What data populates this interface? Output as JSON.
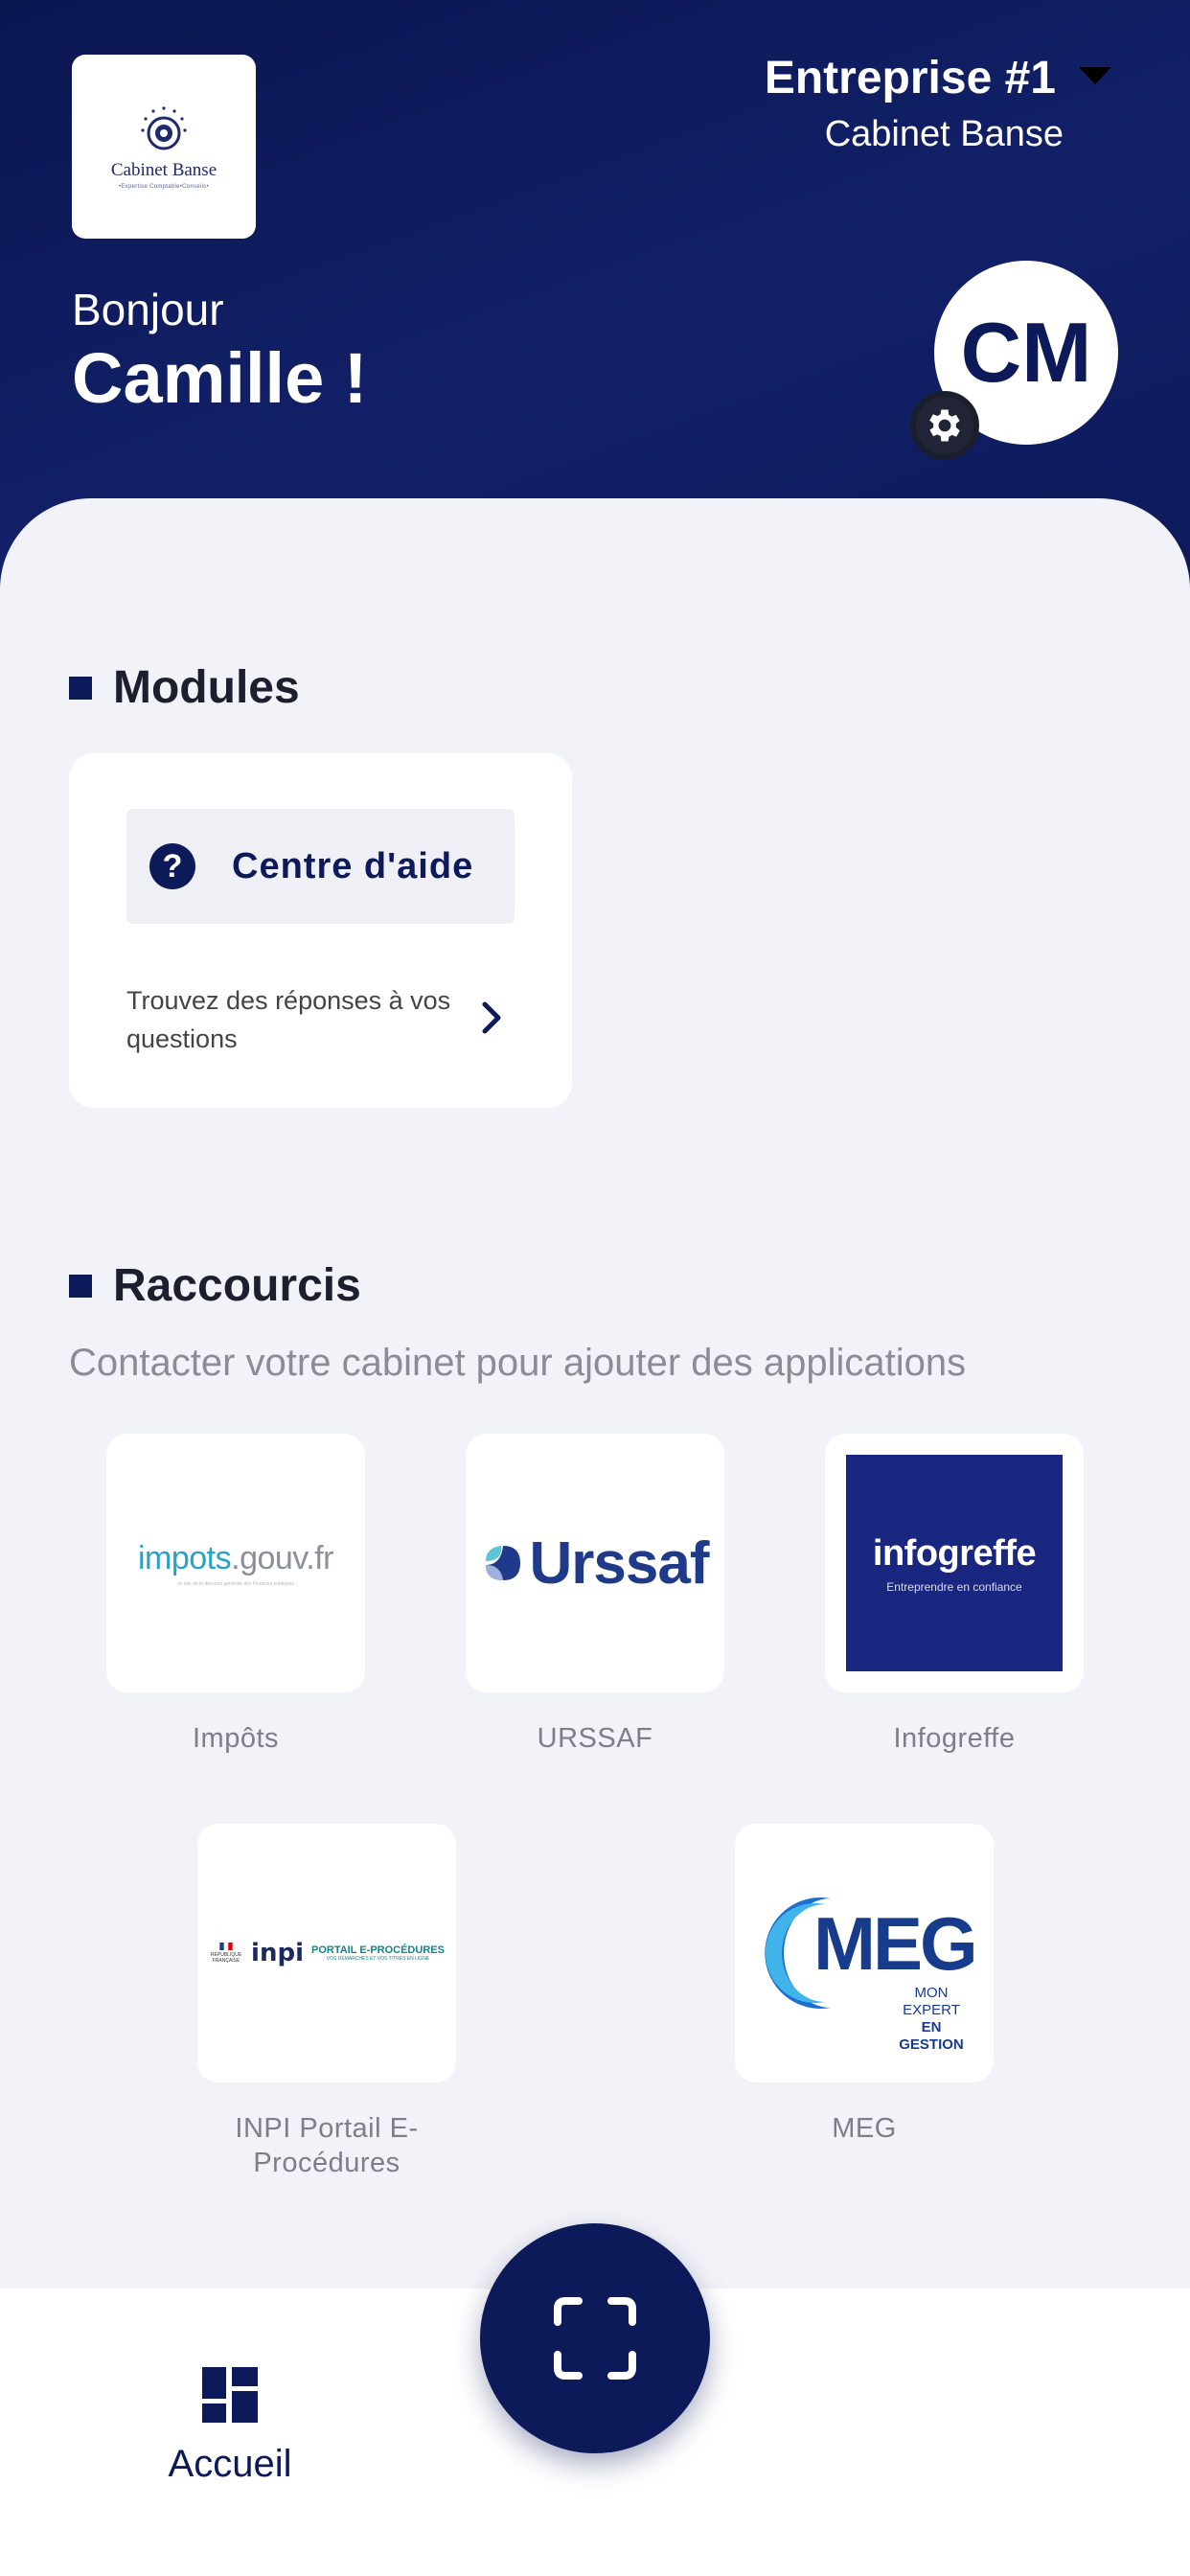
{
  "header": {
    "logo": {
      "name": "Cabinet Banse",
      "tagline": "•Expertise Comptable•Conseils•"
    },
    "company": {
      "name": "Entreprise #1",
      "firm": "Cabinet Banse"
    },
    "greeting": "Bonjour",
    "user_name": "Camille !",
    "avatar_initials": "CM"
  },
  "modules": {
    "title": "Modules",
    "items": [
      {
        "label": "Centre d'aide",
        "description": "Trouvez des réponses à vos questions",
        "icon": "question-icon"
      }
    ]
  },
  "shortcuts": {
    "title": "Raccourcis",
    "subtitle": "Contacter votre cabinet pour ajouter des applications",
    "apps": [
      {
        "label": "Impôts",
        "logo_text": "impots",
        "logo_text2": ".gouv.fr",
        "logo_sub": "un site de la direction générale des Finances publiques"
      },
      {
        "label": "URSSAF",
        "logo_text": "Urssaf"
      },
      {
        "label": "Infogreffe",
        "logo_text": "infogreffe",
        "logo_sub": "Entreprendre en confiance"
      },
      {
        "label": "INPI Portail E-Procédures",
        "logo_text": "inpi",
        "logo_sub": "PORTAIL E-PROCÉDURES",
        "logo_sub2": "VOS DÉMARCHES ET VOS TITRES EN LIGNE",
        "logo_rep": "RÉPUBLIQUE FRANÇAISE"
      },
      {
        "label": "MEG",
        "logo_text": "MEG",
        "logo_sub": "MON EXPERT",
        "logo_sub2": "EN GESTION"
      }
    ]
  },
  "tabbar": {
    "home_label": "Accueil"
  },
  "colors": {
    "primary": "#0d1a5a",
    "background": "#f2f3f8"
  }
}
